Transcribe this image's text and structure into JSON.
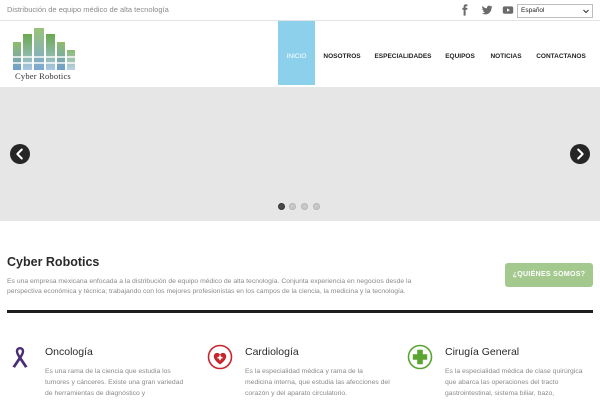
{
  "topbar": {
    "tagline": "Distribución de equipo médico de alta tecnología",
    "social": [
      {
        "icon": "facebook-icon"
      },
      {
        "icon": "twitter-icon"
      },
      {
        "icon": "youtube-icon"
      }
    ],
    "language": {
      "selected": "Español"
    }
  },
  "header": {
    "logo_text": "Cyber Robotics",
    "nav": [
      {
        "label": "INICIO",
        "active": true
      },
      {
        "label": "NOSOTROS",
        "active": false
      },
      {
        "label": "ESPECIALIDADES",
        "active": false
      },
      {
        "label": "EQUIPOS",
        "active": false
      },
      {
        "label": "NOTICIAS",
        "active": false
      },
      {
        "label": "CONTACTANOS",
        "active": false
      }
    ]
  },
  "slider": {
    "slide_count": 4,
    "active_slide": 1,
    "prev_icon": "chevron-left-icon",
    "next_icon": "chevron-right-icon"
  },
  "intro": {
    "title": "Cyber Robotics",
    "text": "Es una empresa mexicana enfocada a la distribución de equipo médico de alta tecnología. Conjunta experiencia en negocios desde la perspectiva económica y técnica; trabajando con los mejores profesionistas en los campos de la ciencia, la medicina y la tecnología.",
    "button_label": "¿QUIÉNES SOMOS?"
  },
  "features": [
    {
      "title": "Oncología",
      "icon": "ribbon-icon",
      "text": "Es una rama de la ciencia que estudia los tumores y cánceres. Existe una gran variedad de herramientas de diagnóstico y"
    },
    {
      "title": "Cardiología",
      "icon": "heart-plus-icon",
      "text": "Es la especialidad médica y rama de la medicina interna, que estudia las afecciones del corazón y del aparato circulatorio."
    },
    {
      "title": "Cirugía General",
      "icon": "medical-cross-icon",
      "text": "Es la especialidad médica de clase quirúrgica que abarca las operaciones del tracto gastrointestinal, sistema biliar, bazo,"
    }
  ],
  "colors": {
    "nav_active": "#8dd0ec",
    "cta_button": "#a4c98f",
    "divider": "#1e1e1e",
    "slider_bg": "#e6e6e6",
    "ribbon": "#4b2d74",
    "heart": "#c8242b",
    "cross": "#5aa532"
  }
}
